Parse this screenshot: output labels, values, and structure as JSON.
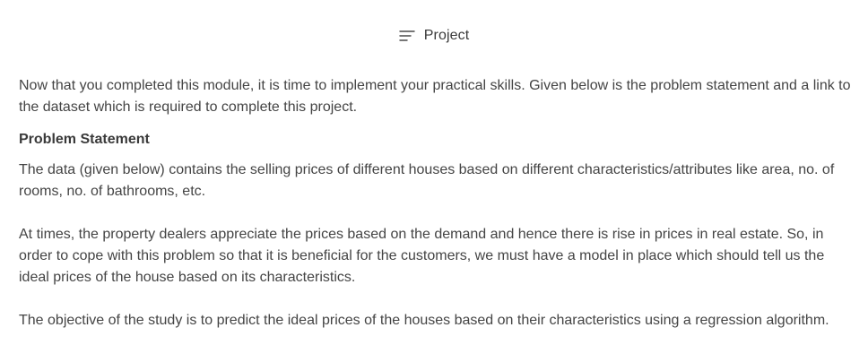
{
  "header": {
    "icon": "menu-lines-icon",
    "title": "Project"
  },
  "content": {
    "intro": "Now that you completed this module, it is time to implement your practical skills. Given below is the problem statement and a link to the dataset which is required to complete this project.",
    "problem_heading": "Problem Statement",
    "paragraph_1": "The data (given below) contains the selling prices of different houses based on different characteristics/attributes like area, no. of rooms, no. of bathrooms, etc.",
    "paragraph_2": "At times, the property dealers appreciate the prices based on the demand and hence there is rise in prices in real estate. So, in order to cope with this problem so that it is beneficial for the customers, we must have a model in place which should tell us the ideal prices of the house based on its characteristics.",
    "paragraph_3": "The objective of the study is to predict the ideal prices of the houses based on their characteristics using a regression algorithm."
  }
}
